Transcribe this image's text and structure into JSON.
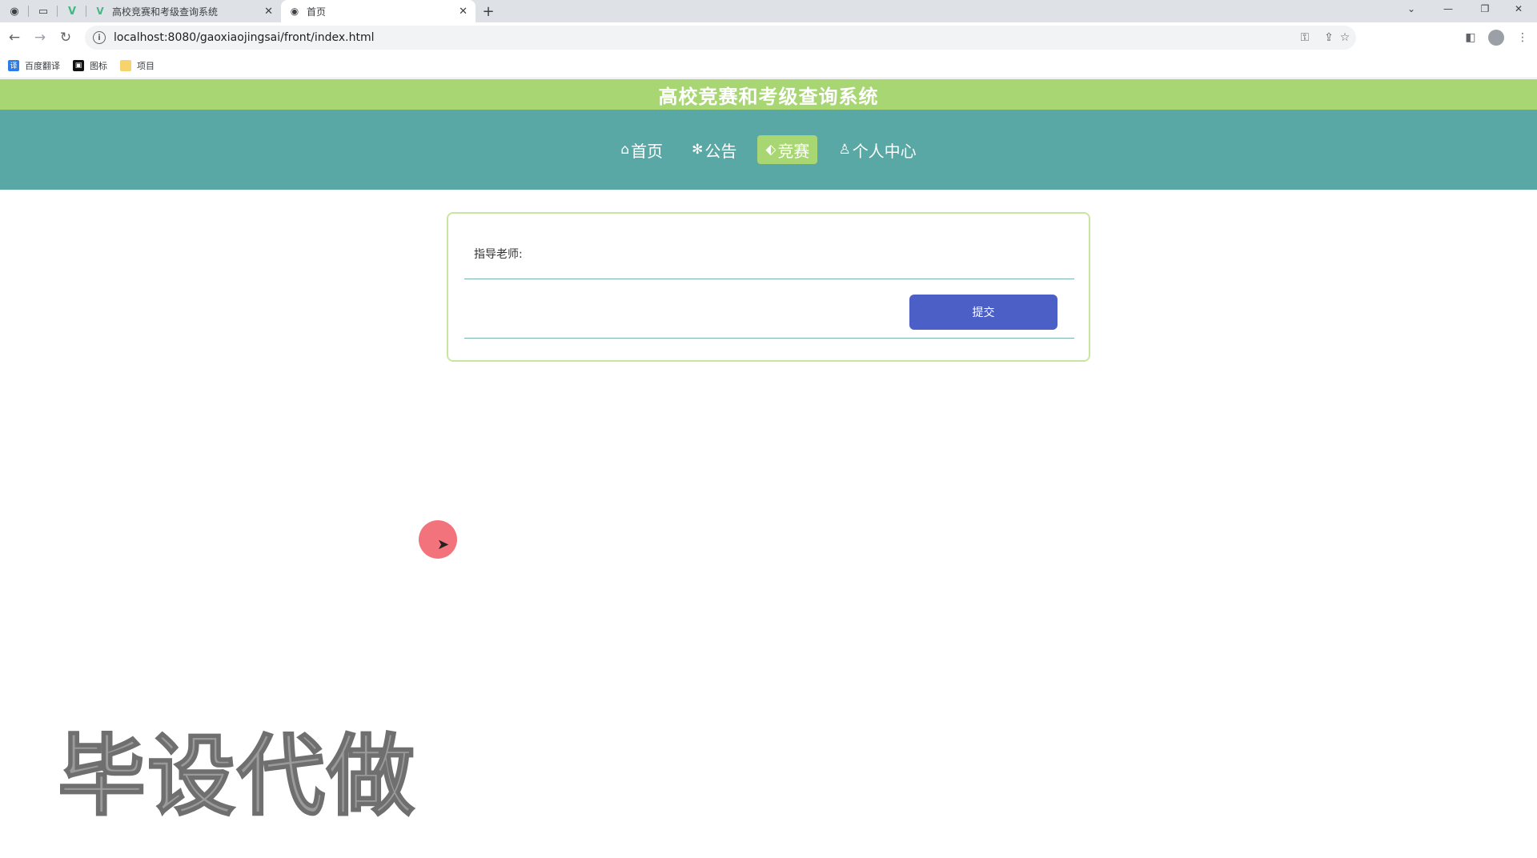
{
  "browser": {
    "tabs": [
      {
        "title": "高校竞赛和考级查询系统",
        "active": false
      },
      {
        "title": "首页",
        "active": true
      }
    ],
    "url": "localhost:8080/gaoxiaojingsai/front/index.html",
    "bookmarks": [
      {
        "label": "百度翻译",
        "icon": "translate-icon"
      },
      {
        "label": "图标",
        "icon": "image-icon"
      },
      {
        "label": "项目",
        "icon": "folder-icon"
      }
    ]
  },
  "site": {
    "title": "高校竞赛和考级查询系统",
    "nav": [
      {
        "label": "首页",
        "icon": "home-icon",
        "active": false
      },
      {
        "label": "公告",
        "icon": "snowflake-icon",
        "active": false
      },
      {
        "label": "竞赛",
        "icon": "tag-icon",
        "active": true
      },
      {
        "label": "个人中心",
        "icon": "user-icon",
        "active": false
      }
    ]
  },
  "form": {
    "teacher_label": "指导老师:",
    "submit_label": "提交"
  },
  "watermark": "毕设代做",
  "colors": {
    "title_bar": "#a8d672",
    "nav_bar": "#5aa8a6",
    "submit_button": "#4b5fc6",
    "card_border": "#c8e6a0"
  }
}
